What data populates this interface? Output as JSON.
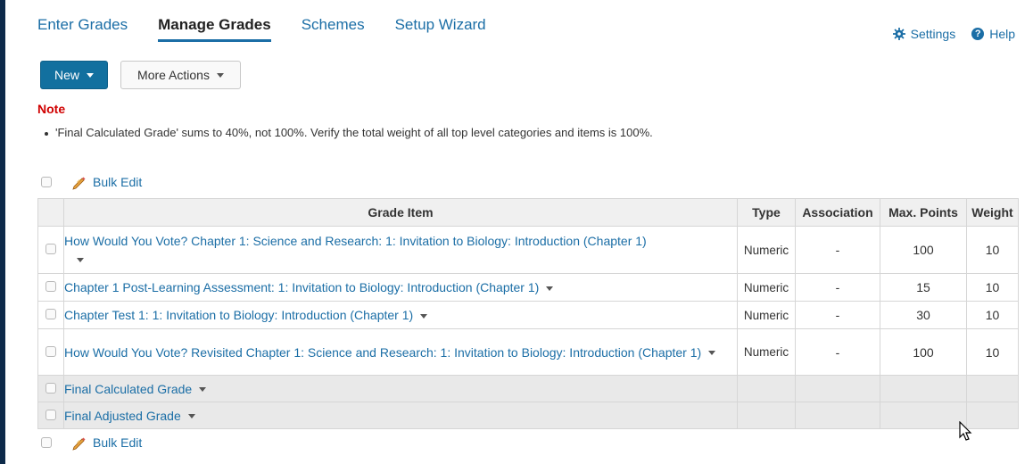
{
  "tabs": [
    {
      "label": "Enter Grades"
    },
    {
      "label": "Manage Grades",
      "active": true
    },
    {
      "label": "Schemes"
    },
    {
      "label": "Setup Wizard"
    }
  ],
  "top_links": {
    "settings": "Settings",
    "help": "Help"
  },
  "toolbar": {
    "new_label": "New",
    "more_actions_label": "More Actions"
  },
  "note": {
    "title": "Note",
    "message": "'Final Calculated Grade' sums to 40%, not 100%. Verify the total weight of all top level categories and items is 100%."
  },
  "bulk_edit_label": "Bulk Edit",
  "table": {
    "headers": {
      "item": "Grade Item",
      "type": "Type",
      "association": "Association",
      "max_points": "Max. Points",
      "weight": "Weight"
    },
    "rows": [
      {
        "name": "How Would You Vote? Chapter 1: Science and Research: 1: Invitation to Biology: Introduction (Chapter 1)",
        "type": "Numeric",
        "association": "-",
        "max_points": "100",
        "weight": "10"
      },
      {
        "name": "Chapter 1 Post-Learning Assessment: 1: Invitation to Biology: Introduction (Chapter 1)",
        "type": "Numeric",
        "association": "-",
        "max_points": "15",
        "weight": "10"
      },
      {
        "name": "Chapter Test 1: 1: Invitation to Biology: Introduction (Chapter 1)",
        "type": "Numeric",
        "association": "-",
        "max_points": "30",
        "weight": "10"
      },
      {
        "name": "How Would You Vote? Revisited Chapter 1: Science and Research: 1: Invitation to Biology: Introduction (Chapter 1)",
        "type": "Numeric",
        "association": "-",
        "max_points": "100",
        "weight": "10"
      }
    ],
    "special_rows": [
      {
        "name": "Final Calculated Grade"
      },
      {
        "name": "Final Adjusted Grade"
      }
    ]
  },
  "colors": {
    "accent": "#1b6ea6",
    "primary_button": "#12709f",
    "note": "#d00000"
  },
  "icons": [
    "gear-icon",
    "help-icon",
    "pencil-icon",
    "chevron-down-icon",
    "mouse-cursor-icon"
  ]
}
